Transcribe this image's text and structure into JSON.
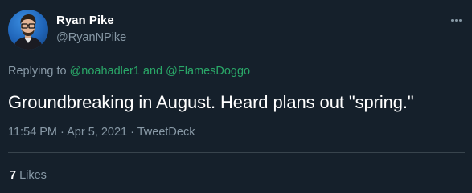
{
  "author": {
    "name": "Ryan Pike",
    "handle": "@RyanNPike"
  },
  "reply": {
    "prefix": "Replying to",
    "user1": "@noahadler1",
    "joiner": "and",
    "user2": "@FlamesDoggo"
  },
  "tweet": {
    "text": "Groundbreaking in August. Heard plans out \"spring.\""
  },
  "meta": {
    "time": "11:54 PM",
    "separator1": "·",
    "date": "Apr 5, 2021",
    "separator2": "·",
    "source": "TweetDeck"
  },
  "stats": {
    "likes_count": "7",
    "likes_label": "Likes"
  },
  "colors": {
    "background": "#15202b",
    "mention": "#2aa768",
    "secondary_text": "#8899a6",
    "divider": "#38444d"
  },
  "icons": {
    "more": "more-horizontal-icon"
  }
}
